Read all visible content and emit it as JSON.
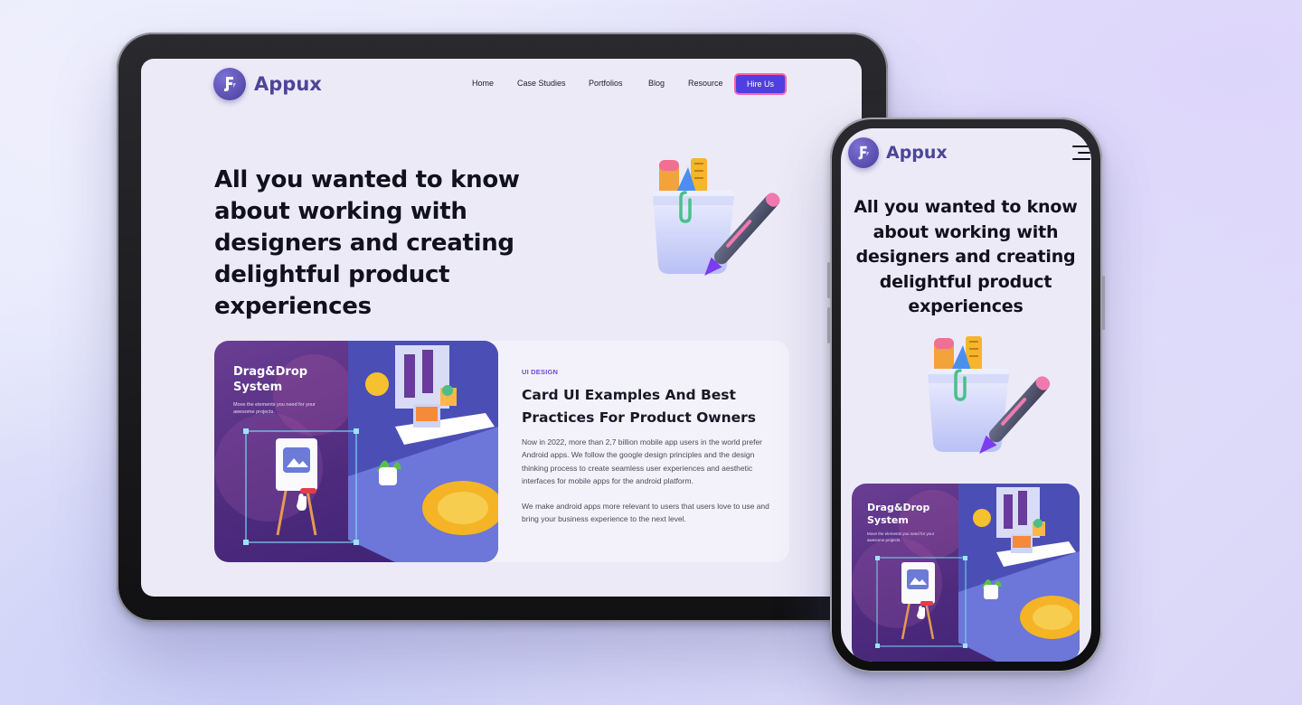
{
  "brand": {
    "name": "Appux"
  },
  "nav": {
    "items": [
      "Home",
      "Case Studies",
      "Portfolios",
      "Blog",
      "Resource"
    ],
    "cta": "Hire Us"
  },
  "hero": {
    "title": "All you wanted to know about working with designers and creating delightful product experiences"
  },
  "card": {
    "image_title": "Drag&Drop System",
    "image_subtitle": "Move the elements you need for your awesome projects.",
    "category": "UI DESIGN",
    "title": "Card UI Examples And Best Practices For Product Owners",
    "paragraph_1": "Now in 2022, more than 2,7 billion mobile app users in the world prefer Android apps. We follow the google design principles and the design thinking process to create seamless user experiences and aesthetic interfaces for mobile apps for the android platform.",
    "paragraph_2": "We make android apps more relevant to users that users love to use and bring your business experience to the next level."
  },
  "icons": {
    "logo": "appux-logo-icon",
    "menu": "hamburger-menu-icon",
    "hero_art": "stationery-cup-pen-illustration",
    "card_art": "isometric-workspace-illustration"
  },
  "colors": {
    "brand": "#4d4597",
    "cta_bg": "#4f3fe0",
    "cta_border": "#ff5fa8",
    "category": "#6b4bd6",
    "card_image_bg": "#5a3389",
    "page_bg": "#eceaf6"
  }
}
